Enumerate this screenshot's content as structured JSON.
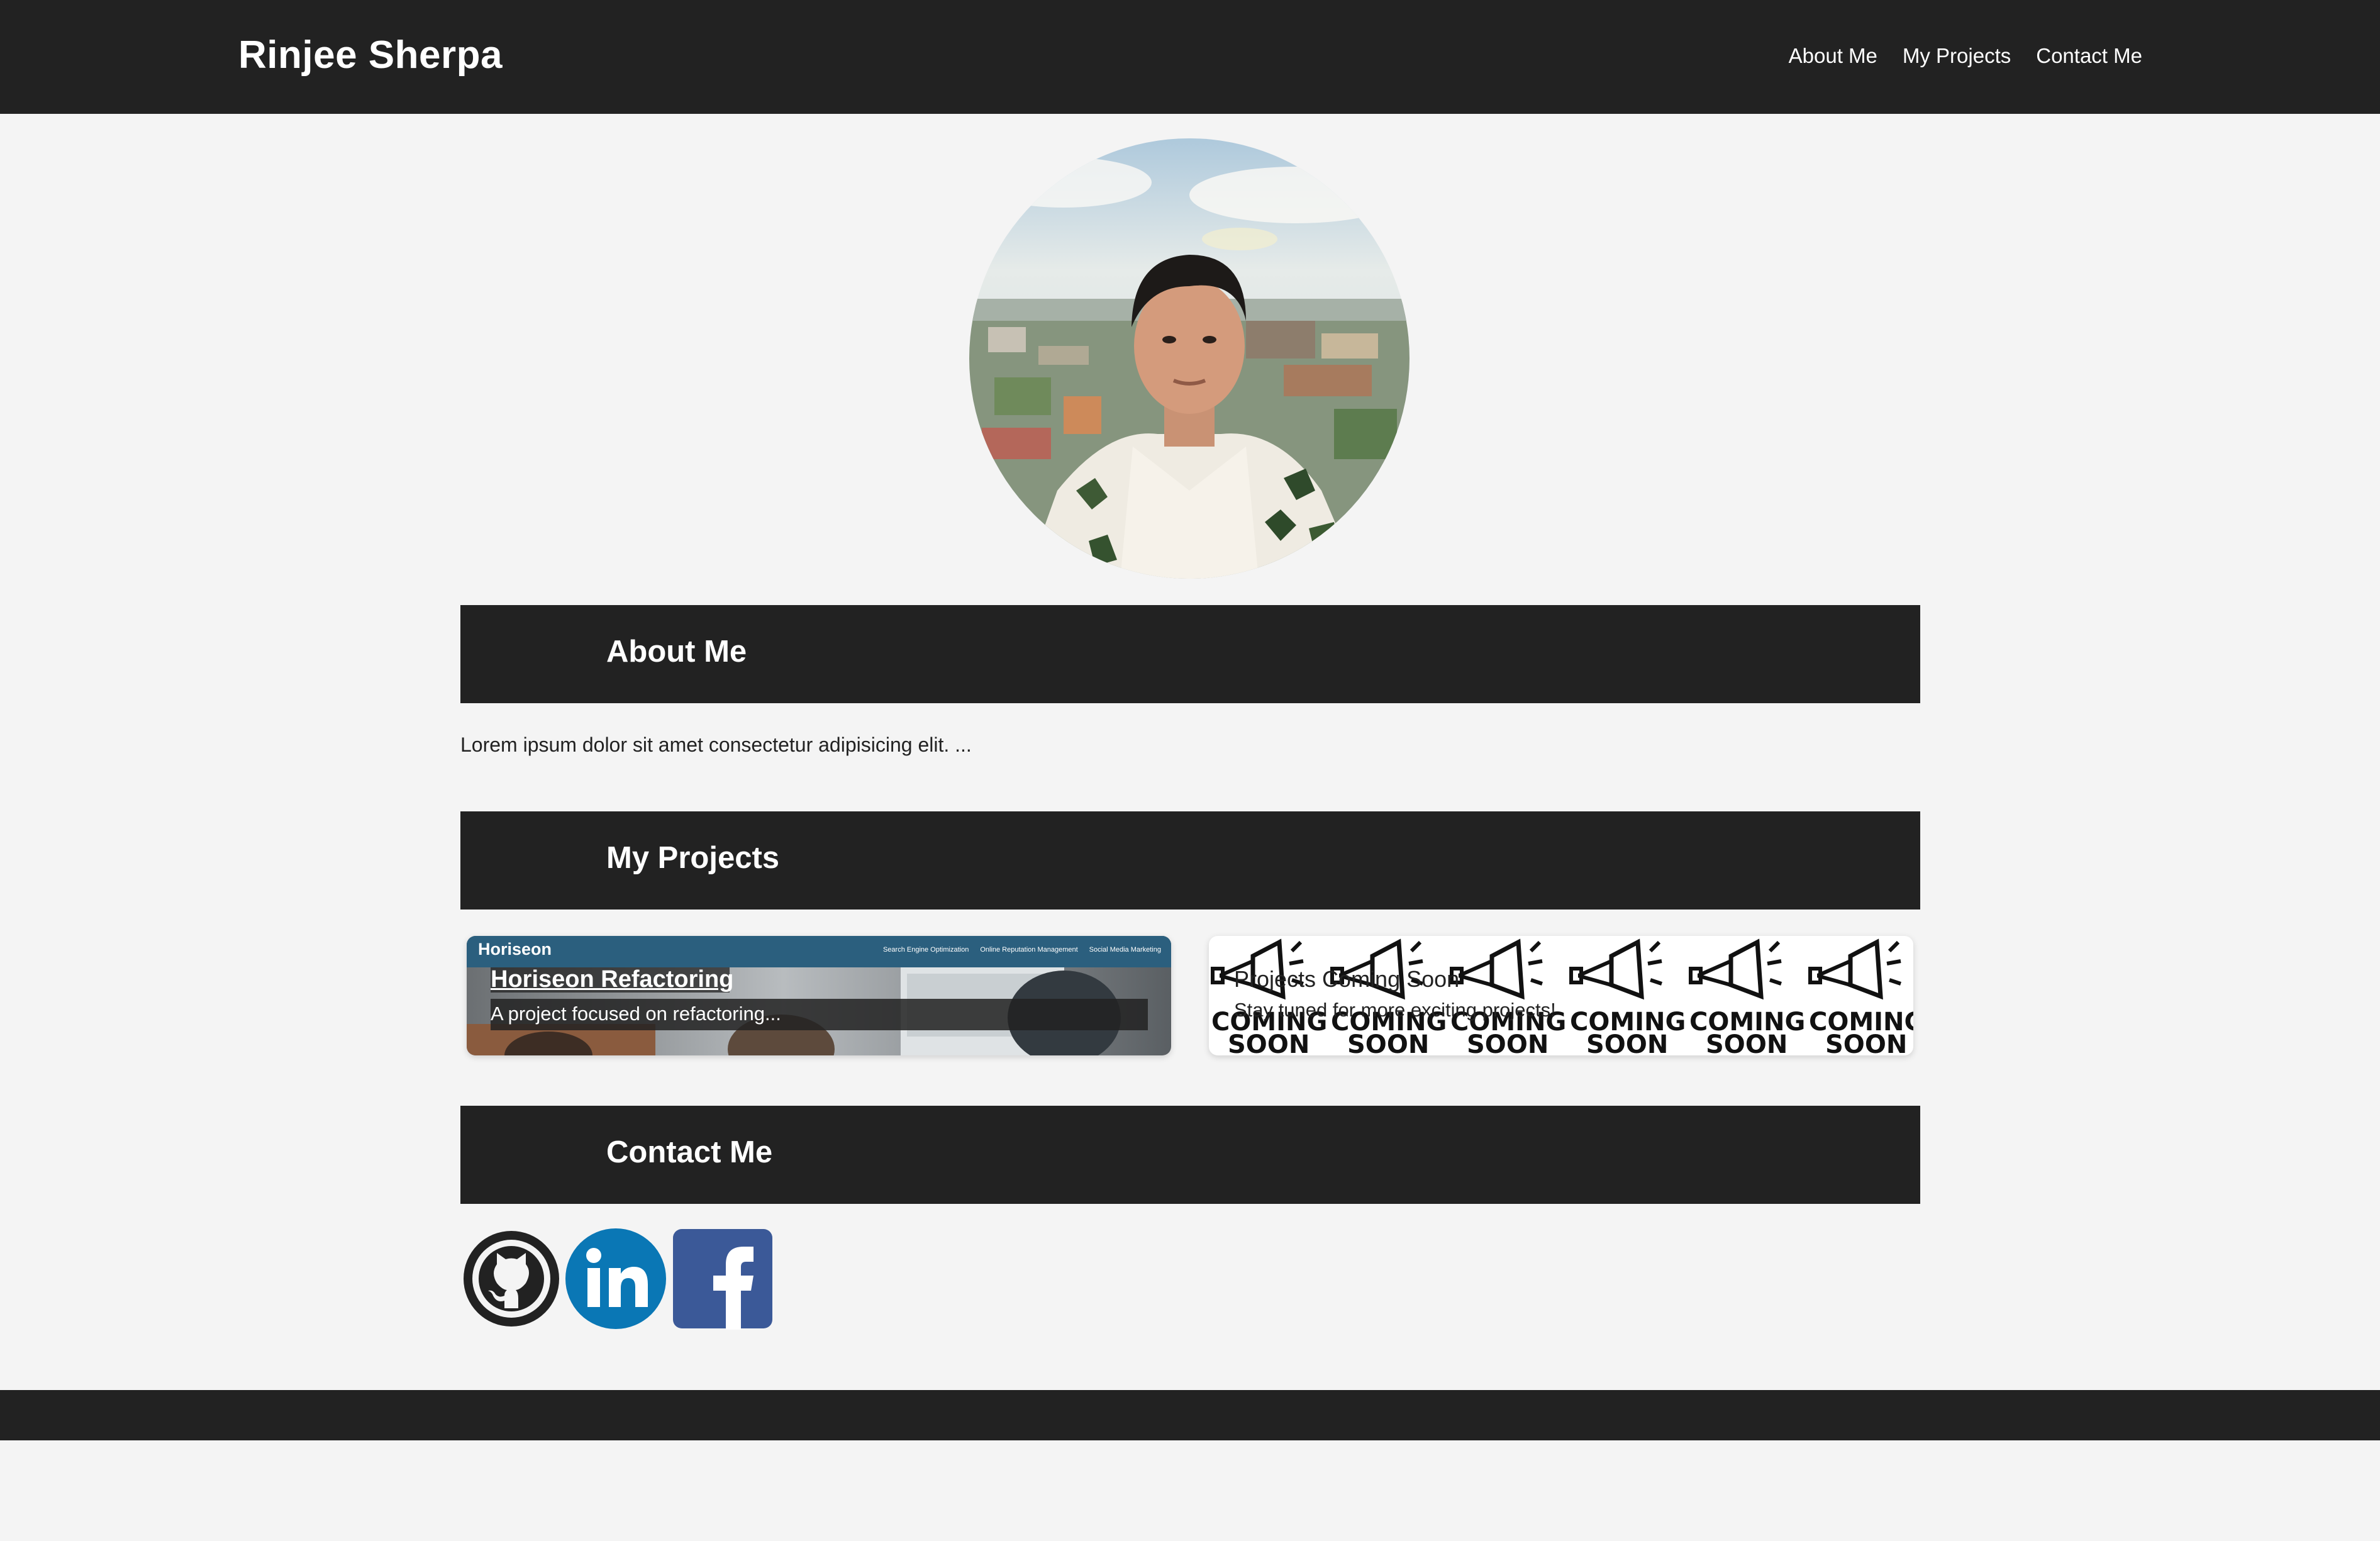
{
  "header": {
    "brand": "Rinjee Sherpa",
    "nav": [
      "About Me",
      "My Projects",
      "Contact Me"
    ]
  },
  "profile": {
    "image": "portrait-photo"
  },
  "about": {
    "heading": "About Me",
    "text": "Lorem ipsum dolor sit amet consectetur adipisicing elit. ..."
  },
  "projects": {
    "heading": "My Projects",
    "items": [
      {
        "title": "Horiseon Refactoring",
        "description": "A project focused on refactoring...",
        "screenshot": {
          "logo": "Horiseon",
          "nav": [
            "Search Engine Optimization",
            "Online Reputation Management",
            "Social Media Marketing"
          ]
        }
      },
      {
        "title": "Projects Coming Soon",
        "description": "Stay tuned for more exciting projects!",
        "banner": {
          "line1": "COMING",
          "line2": "SOON",
          "icon": "megaphone-icon"
        }
      }
    ]
  },
  "contact": {
    "heading": "Contact Me",
    "links": [
      {
        "name": "github",
        "icon": "github-icon",
        "color": "#222222"
      },
      {
        "name": "linkedin",
        "icon": "linkedin-icon",
        "color": "#0a77b5"
      },
      {
        "name": "facebook",
        "icon": "facebook-icon",
        "color": "#3b5998"
      }
    ]
  },
  "colors": {
    "dark": "#222222",
    "background": "#f4f4f4",
    "white": "#ffffff"
  }
}
